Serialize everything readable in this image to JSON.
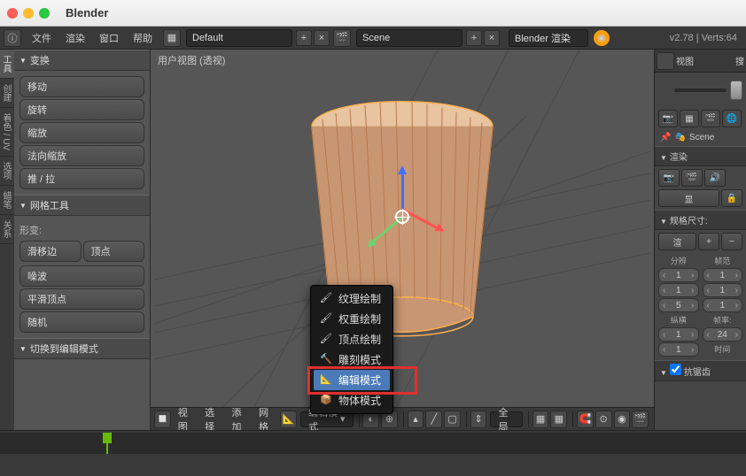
{
  "app": {
    "title": "Blender"
  },
  "topbar": {
    "menus": [
      "文件",
      "渲染",
      "窗口",
      "帮助"
    ],
    "layout": "Default",
    "scene": "Scene",
    "engine": "Blender 渲染",
    "version": "v2.78",
    "stats": "Verts:64"
  },
  "left": {
    "vtabs": [
      "工具",
      "创建",
      "着色 / UV",
      "选项",
      "蜡笔",
      "关系"
    ],
    "panels": {
      "transform": {
        "title": "变换",
        "items": [
          "移动",
          "旋转",
          "缩放",
          "法向缩放",
          "推 / 拉"
        ]
      },
      "meshTools": {
        "title": "网格工具",
        "deformLabel": "形变:",
        "slide": "滑移边",
        "vertex": "顶点",
        "noise": "噪波",
        "smooth": "平滑顶点",
        "random": "随机"
      },
      "switch": {
        "title": "切换到编辑模式"
      }
    }
  },
  "viewport": {
    "title": "用户视图 (透视)",
    "toolbar": {
      "menus": [
        "视图",
        "选择",
        "添加",
        "网格"
      ],
      "modeLabel": "编辑模式",
      "pivot": "全局"
    }
  },
  "modeMenu": {
    "items": [
      {
        "icon": "🖌",
        "label": "纹理绘制"
      },
      {
        "icon": "🖌",
        "label": "权重绘制"
      },
      {
        "icon": "🖌",
        "label": "顶点绘制"
      },
      {
        "icon": "🔨",
        "label": "雕刻模式"
      },
      {
        "icon": "📐",
        "label": "编辑模式",
        "selected": true
      },
      {
        "icon": "📦",
        "label": "物体模式"
      }
    ]
  },
  "right": {
    "viewLabel": "视图",
    "searchLabel": "搜",
    "scene": "Scene",
    "panels": {
      "render": {
        "title": "渲染",
        "display": "显",
        "modeShort": "渲"
      },
      "dims": {
        "title": "规格尺寸:",
        "res": "分辨",
        "frame": "帧范",
        "vals": [
          "1",
          "1",
          "1",
          "1",
          "5"
        ],
        "aspect": "纵横",
        "rate": "帧率:",
        "fps": "24",
        "time": "时间"
      },
      "aa": {
        "title": "抗锯齿"
      }
    }
  }
}
